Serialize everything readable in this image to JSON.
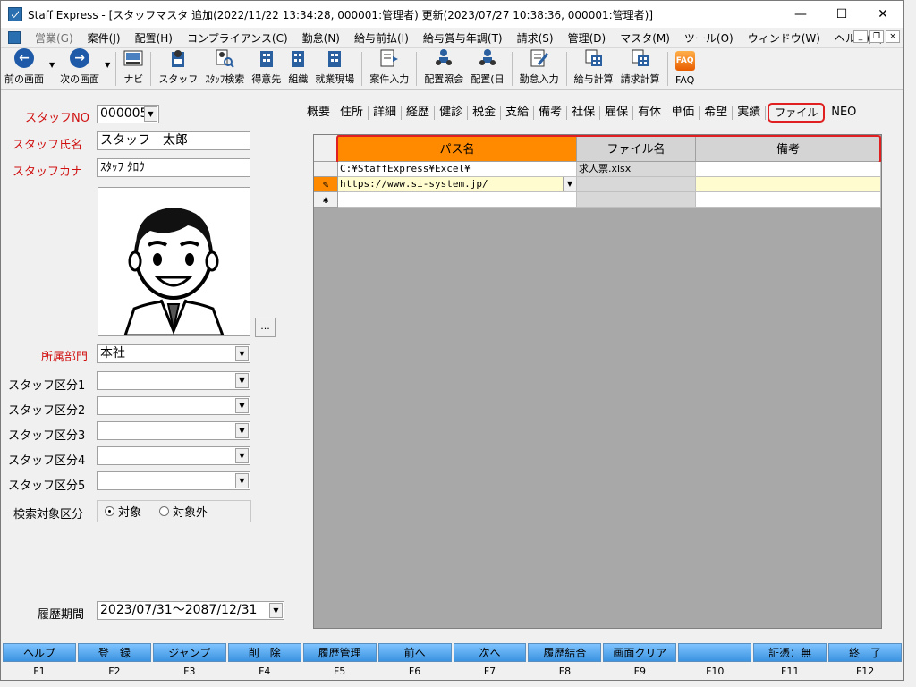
{
  "window": {
    "title": "Staff Express - [スタッフマスタ 追加(2022/11/22 13:34:28, 000001:管理者) 更新(2023/07/27 10:38:36, 000001:管理者)]",
    "minimize": "—",
    "maximize": "☐",
    "close": "✕"
  },
  "menu": {
    "items": [
      "営業(G)",
      "案件(J)",
      "配置(H)",
      "コンプライアンス(C)",
      "勤怠(N)",
      "給与前払(I)",
      "給与賞与年調(T)",
      "請求(S)",
      "管理(D)",
      "マスタ(M)",
      "ツール(O)",
      "ウィンドウ(W)",
      "ヘルプ(H)"
    ],
    "mdi_min": "_",
    "mdi_restore": "❐",
    "mdi_close": "×"
  },
  "toolbar": {
    "prev": "前の画面",
    "next": "次の画面",
    "navi": "ナビ",
    "staff": "スタッフ",
    "staff_search": "ｽﾀｯﾌ検索",
    "client": "得意先",
    "org": "組織",
    "site": "就業現場",
    "case_entry": "案件入力",
    "assign_inquiry": "配置照会",
    "assign_day": "配置(日",
    "attendance": "勤怠入力",
    "payroll": "給与計算",
    "billing": "請求計算",
    "faq": "FAQ",
    "faq_icon": "FAQ"
  },
  "staff": {
    "no_label": "スタッフNO",
    "no_value": "000005",
    "name_label": "スタッフ氏名",
    "name_value": "スタッフ　太郎",
    "kana_label": "スタッフカナ",
    "kana_value": "ｽﾀｯﾌ ﾀﾛｳ",
    "photo_button": "...",
    "dept_label": "所属部門",
    "dept_value": "本社",
    "class1_label": "スタッフ区分1",
    "class2_label": "スタッフ区分2",
    "class3_label": "スタッフ区分3",
    "class4_label": "スタッフ区分4",
    "class5_label": "スタッフ区分5",
    "search_label": "検索対象区分",
    "search_on": "対象",
    "search_off": "対象外",
    "period_label": "履歴期間",
    "period_value": "2023/07/31～2087/12/31"
  },
  "tabs": [
    "概要",
    "住所",
    "詳細",
    "経歴",
    "健診",
    "税金",
    "支給",
    "備考",
    "社保",
    "雇保",
    "有休",
    "単価",
    "希望",
    "実績",
    "ファイル",
    "NEO"
  ],
  "grid": {
    "col_path": "パス名",
    "col_file": "ファイル名",
    "col_note": "備考",
    "rows": [
      {
        "marker": "",
        "path": "C:¥StaffExpress¥Excel¥",
        "file": "求人票.xlsx",
        "note": ""
      },
      {
        "marker": "✎",
        "path": "https://www.si-system.jp/",
        "file": "",
        "note": ""
      },
      {
        "marker": "✱",
        "path": "",
        "file": "",
        "note": ""
      }
    ]
  },
  "fkeys": [
    {
      "label": "ヘルプ",
      "key": "F1"
    },
    {
      "label": "登　録",
      "key": "F2"
    },
    {
      "label": "ジャンプ",
      "key": "F3"
    },
    {
      "label": "削　除",
      "key": "F4"
    },
    {
      "label": "履歴管理",
      "key": "F5"
    },
    {
      "label": "前へ",
      "key": "F6"
    },
    {
      "label": "次へ",
      "key": "F7"
    },
    {
      "label": "履歴結合",
      "key": "F8"
    },
    {
      "label": "画面クリア",
      "key": "F9"
    },
    {
      "label": "",
      "key": "F10"
    },
    {
      "label": "証憑：無",
      "key": "F11"
    },
    {
      "label": "終　了",
      "key": "F12"
    }
  ],
  "colors": {
    "accent_orange": "#ff8a00",
    "highlight_red": "#e02020",
    "label_red": "#d01010",
    "fkey_blue": "#3b93e0",
    "grid_bg": "#a8a8a8"
  }
}
